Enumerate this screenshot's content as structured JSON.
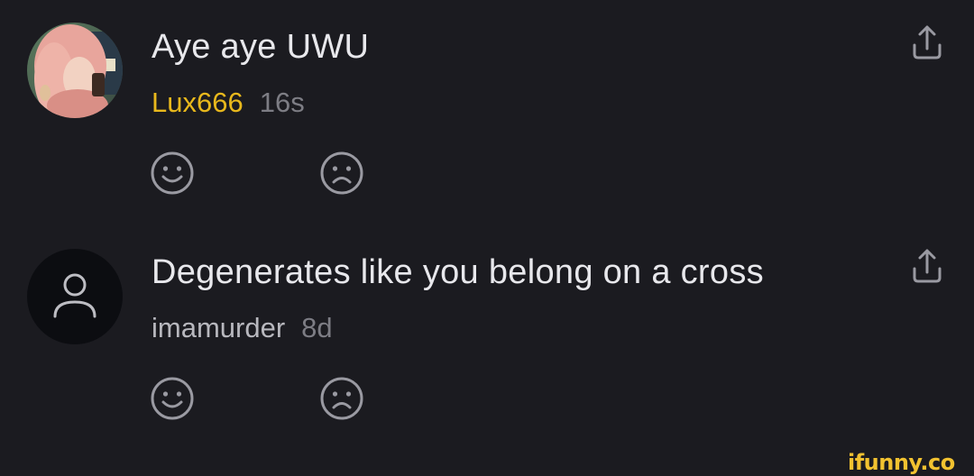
{
  "comments": [
    {
      "text": "Aye aye UWU",
      "username": "Lux666",
      "timestamp": "16s",
      "avatar": "user-photo",
      "username_color": "#e8b81c"
    },
    {
      "text": "Degenerates like you belong on a cross",
      "username": "imamurder",
      "timestamp": "8d",
      "avatar": "default-person-icon",
      "username_color": "#b8b8be"
    }
  ],
  "icons": {
    "like": "smile-icon",
    "dislike": "frown-icon",
    "share": "share-icon"
  },
  "colors": {
    "background": "#1b1b20",
    "icon": "#9a9aa2",
    "watermark": "#f2c230"
  },
  "watermark": "ifunny.co"
}
